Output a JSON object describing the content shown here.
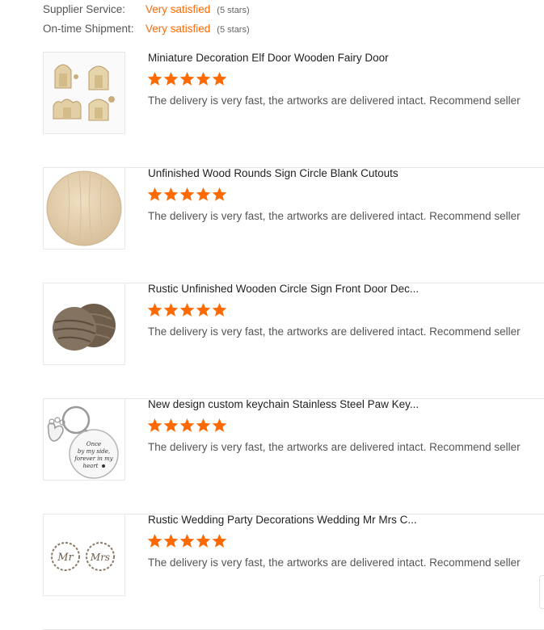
{
  "ratings": [
    {
      "label": "Supplier Service:",
      "value": "Very satisfied",
      "stars": "(5 stars)"
    },
    {
      "label": "On-time Shipment:",
      "value": "Very satisfied",
      "stars": "(5 stars)"
    }
  ],
  "reviews": [
    {
      "title": "Miniature Decoration Elf Door Wooden Fairy Door",
      "text": "The delivery is very fast, the artworks are delivered intact. Recommend seller",
      "stars": 5
    },
    {
      "title": "Unfinished Wood Rounds Sign Circle Blank Cutouts",
      "text": "The delivery is very fast, the artworks are delivered intact. Recommend seller",
      "stars": 5
    },
    {
      "title": "Rustic Unfinished Wooden Circle Sign Front Door Dec...",
      "text": "The delivery is very fast, the artworks are delivered intact. Recommend seller",
      "stars": 5
    },
    {
      "title": "New design custom keychain Stainless Steel Paw Key...",
      "text": "The delivery is very fast, the artworks are delivered intact. Recommend seller",
      "stars": 5
    },
    {
      "title": "Rustic Wedding Party Decorations Wedding Mr Mrs C...",
      "text": "The delivery is very fast, the artworks are delivered intact. Recommend seller",
      "stars": 5
    }
  ],
  "keychain_text": [
    "Once",
    "by my side,",
    "forever in my",
    "heart"
  ],
  "wedding_text": [
    "Mr",
    "Mrs"
  ],
  "colors": {
    "accent": "#ff6a00",
    "star": "#ff6a00"
  },
  "icons": {
    "star": "star-icon"
  }
}
